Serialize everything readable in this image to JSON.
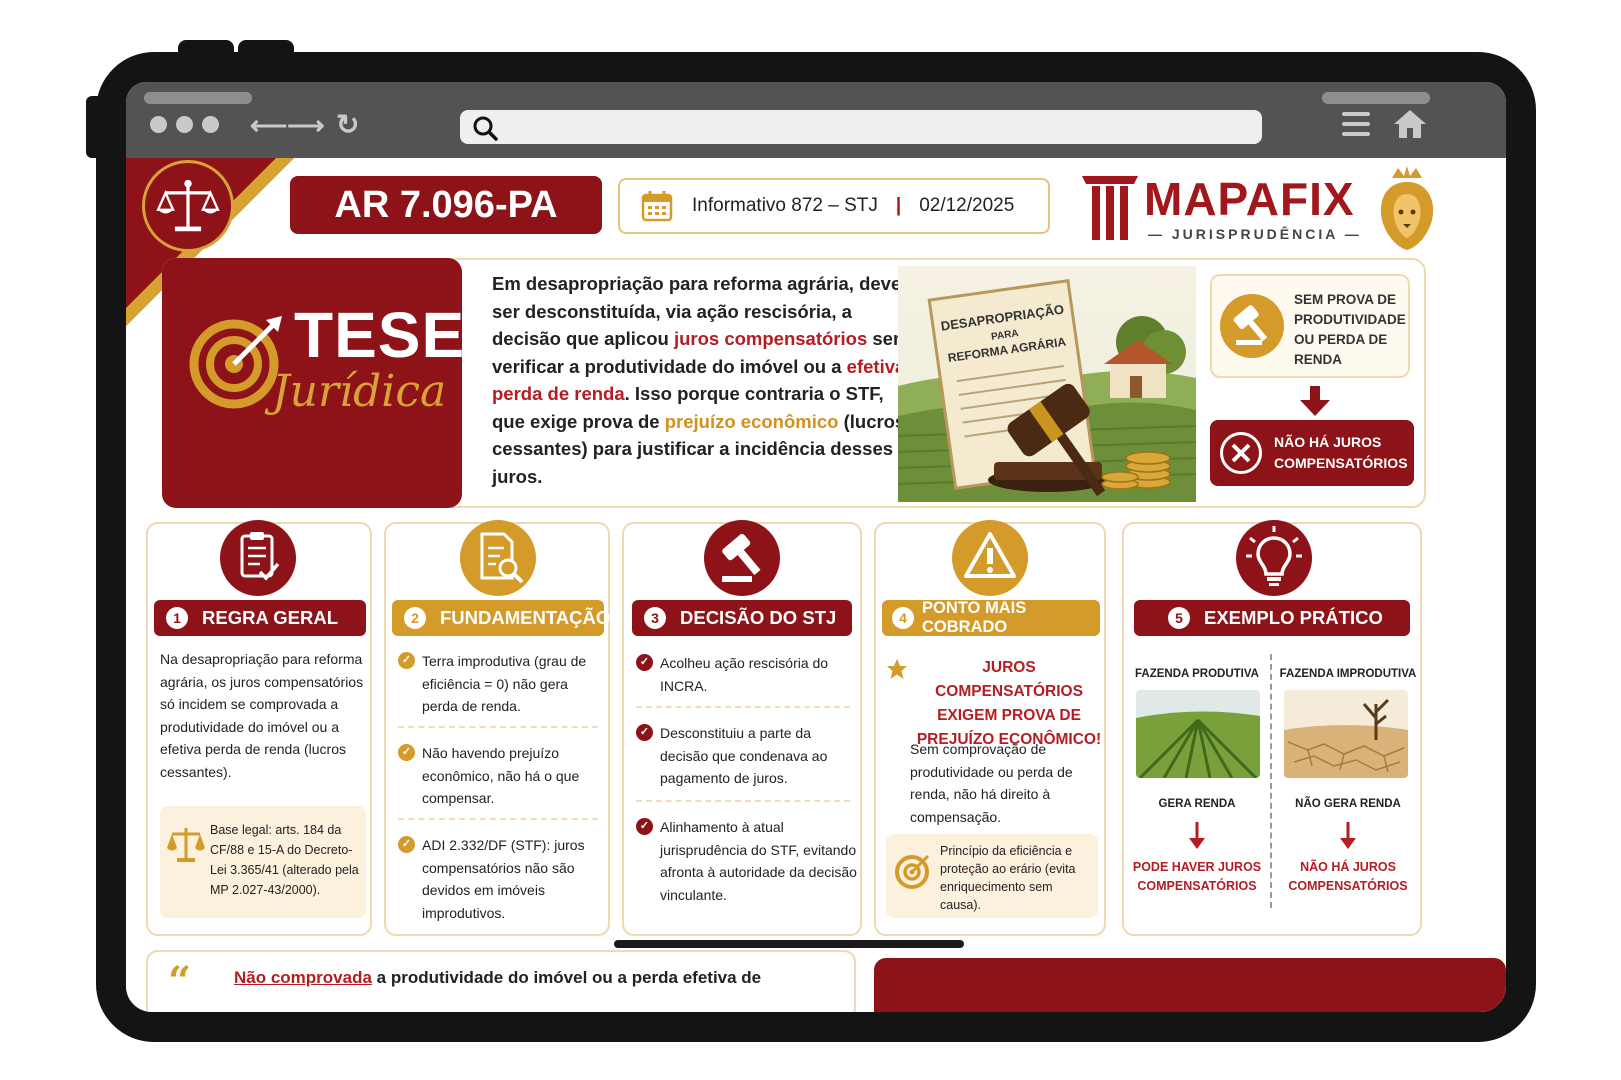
{
  "browser": {
    "search_icon": "search-icon",
    "menu_icon": "menu-icon",
    "home_icon": "home-icon"
  },
  "colors": {
    "brand_red": "#8d1318",
    "accent_red": "#b51d22",
    "brand_gold": "#d49a2a",
    "border_beige": "#efd9ae"
  },
  "header": {
    "case_number": "AR 7.096-PA",
    "informativo": "Informativo 872 – STJ",
    "separator": "|",
    "date": "02/12/2025",
    "logo_name": "MAPAFIX",
    "logo_sub": "— JURISPRUDÊNCIA —"
  },
  "thesis": {
    "title": "TESE",
    "subtitle": "Jurídica",
    "text_1": "Em desapropriação para reforma agrária, deve ser desconstituída, via ação rescisória, a decisão que aplicou ",
    "text_hl_1": "juros compensatórios",
    "text_2": " sem verificar a produtividade do imóvel ou a ",
    "text_hl_2": "efetiva perda de renda",
    "text_3": ". Isso porque contraria o STF, que exige prova de ",
    "text_hl_3": "prejuízo econômico",
    "text_4": " (lucros cessantes) para justificar a incidência desses juros.",
    "doc_line_1": "DESAPROPRIAÇÃO",
    "doc_line_2": "PARA",
    "doc_line_3": "REFORMA AGRÁRIA",
    "sem_prova": "SEM PROVA DE PRODUTIVIDADE OU PERDA DE RENDA",
    "nao_ha": "NÃO HÁ JUROS COMPENSATÓRIOS"
  },
  "cards": {
    "regra": {
      "num": "1",
      "title": "REGRA GERAL",
      "body": "Na desapropriação para reforma agrária, os juros compensatórios só incidem se comprovada a produtividade do imóvel ou a efetiva perda de renda (lucros cessantes).",
      "legal": "Base legal: arts. 184 da CF/88 e 15-A do Decreto-Lei 3.365/41 (alterado pela MP 2.027-43/2000)."
    },
    "fundamentacao": {
      "num": "2",
      "title": "FUNDAMENTAÇÃO",
      "items": [
        "Terra improdutiva (grau de eficiência = 0) não gera perda de renda.",
        "Não havendo prejuízo econômico, não há o que compensar.",
        "ADI 2.332/DF (STF): juros compensatórios não são devidos em imóveis improdutivos."
      ]
    },
    "decisao": {
      "num": "3",
      "title": "DECISÃO DO STJ",
      "items": [
        "Acolheu ação rescisória do INCRA.",
        "Desconstituiu a parte da decisão que condenava ao pagamento de juros.",
        "Alinhamento à atual jurisprudência do STF, evitando afronta à autoridade da decisão vinculante."
      ]
    },
    "ponto": {
      "num": "4",
      "title": "PONTO MAIS COBRADO",
      "highlight": "JUROS COMPENSATÓRIOS EXIGEM PROVA DE PREJUÍZO ECONÔMICO!",
      "body": "Sem comprovação de produtividade ou perda de renda, não há direito à compensação.",
      "principle": "Princípio da eficiência e proteção ao erário (evita enriquecimento sem causa)."
    },
    "exemplo": {
      "num": "5",
      "title": "EXEMPLO PRÁTICO",
      "left_label": "FAZENDA PRODUTIVA",
      "left_status": "GERA RENDA",
      "left_result": "PODE HAVER JUROS COMPENSATÓRIOS",
      "right_label": "FAZENDA IMPRODUTIVA",
      "right_status": "NÃO GERA RENDA",
      "right_result": "NÃO HÁ JUROS COMPENSATÓRIOS"
    }
  },
  "footer": {
    "quote_hl": "Não comprovada",
    "quote_rest": " a produtividade do imóvel ou a perda efetiva de"
  }
}
